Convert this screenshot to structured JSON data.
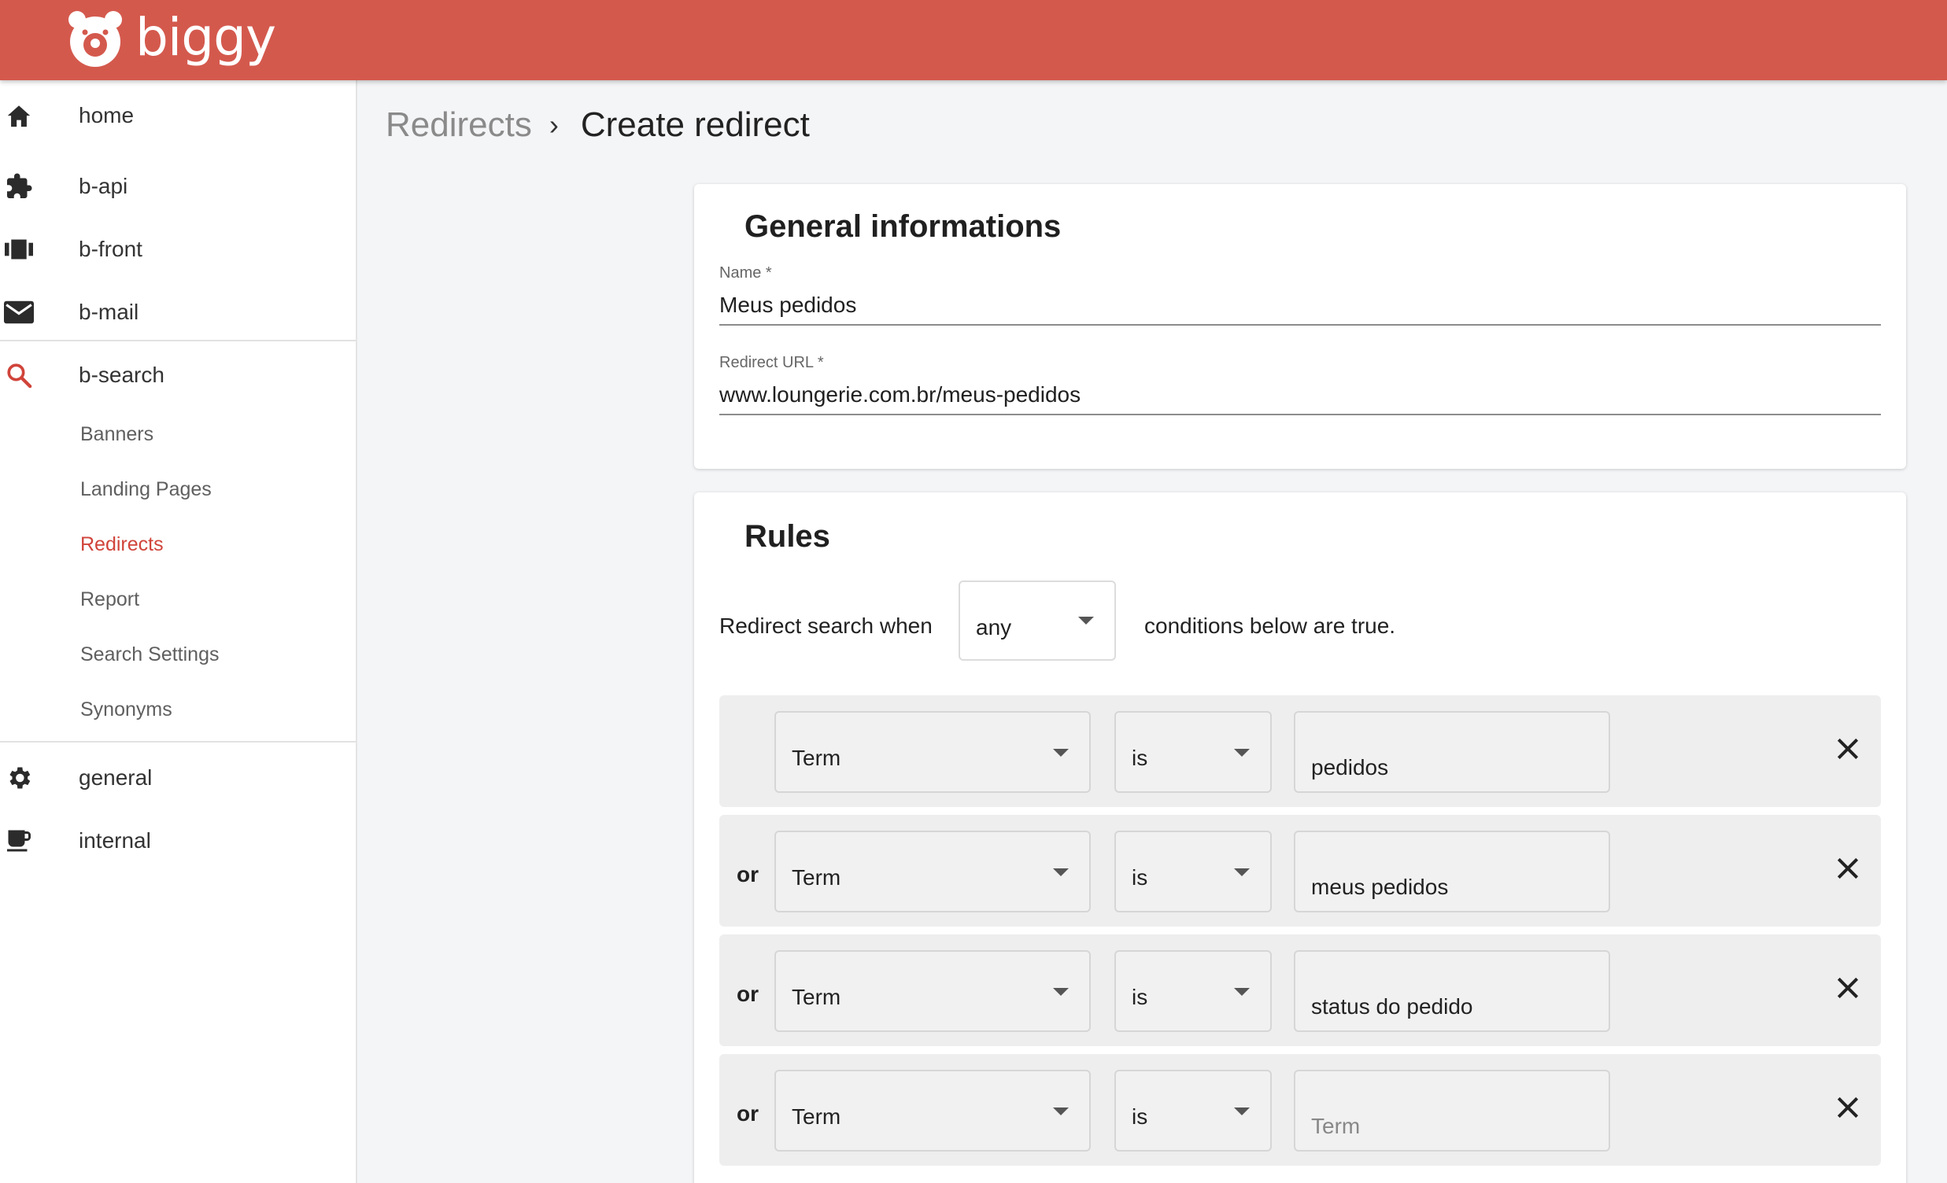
{
  "header": {
    "logo_text": "biggy",
    "bg_color": "#d4594d"
  },
  "sidebar": {
    "sections": [
      {
        "label": "home",
        "icon": "home-icon"
      },
      {
        "label": "b-api",
        "icon": "puzzle-icon"
      },
      {
        "label": "b-front",
        "icon": "carousel-icon"
      },
      {
        "label": "b-mail",
        "icon": "mail-icon"
      },
      {
        "label": "b-search",
        "icon": "search-icon",
        "active": true
      },
      {
        "label": "general",
        "icon": "gear-icon"
      },
      {
        "label": "internal",
        "icon": "coffee-icon"
      }
    ],
    "b_search_items": [
      {
        "label": "Banners"
      },
      {
        "label": "Landing Pages"
      },
      {
        "label": "Redirects",
        "active": true
      },
      {
        "label": "Report"
      },
      {
        "label": "Search Settings"
      },
      {
        "label": "Synonyms"
      }
    ],
    "active_color": "#d0443a"
  },
  "breadcrumb": {
    "parent": "Redirects",
    "separator": "›",
    "current": "Create redirect"
  },
  "general": {
    "title": "General informations",
    "name_label": "Name *",
    "name_value": "Meus pedidos",
    "url_label": "Redirect URL *",
    "url_value": "www.loungerie.com.br/meus-pedidos"
  },
  "rules": {
    "title": "Rules",
    "prefix": "Redirect search when",
    "match_mode": "any",
    "suffix": "conditions below are true.",
    "conditions": [
      {
        "connector": "",
        "field": "Term",
        "operator": "is",
        "value": "",
        "display": "pedidos"
      },
      {
        "connector": "or",
        "field": "Term",
        "operator": "is",
        "value": "meus pedidos"
      },
      {
        "connector": "or",
        "field": "Term",
        "operator": "is",
        "value": "status do pedido"
      },
      {
        "connector": "or",
        "field": "Term",
        "operator": "is",
        "value": "",
        "placeholder": "Term"
      }
    ]
  }
}
